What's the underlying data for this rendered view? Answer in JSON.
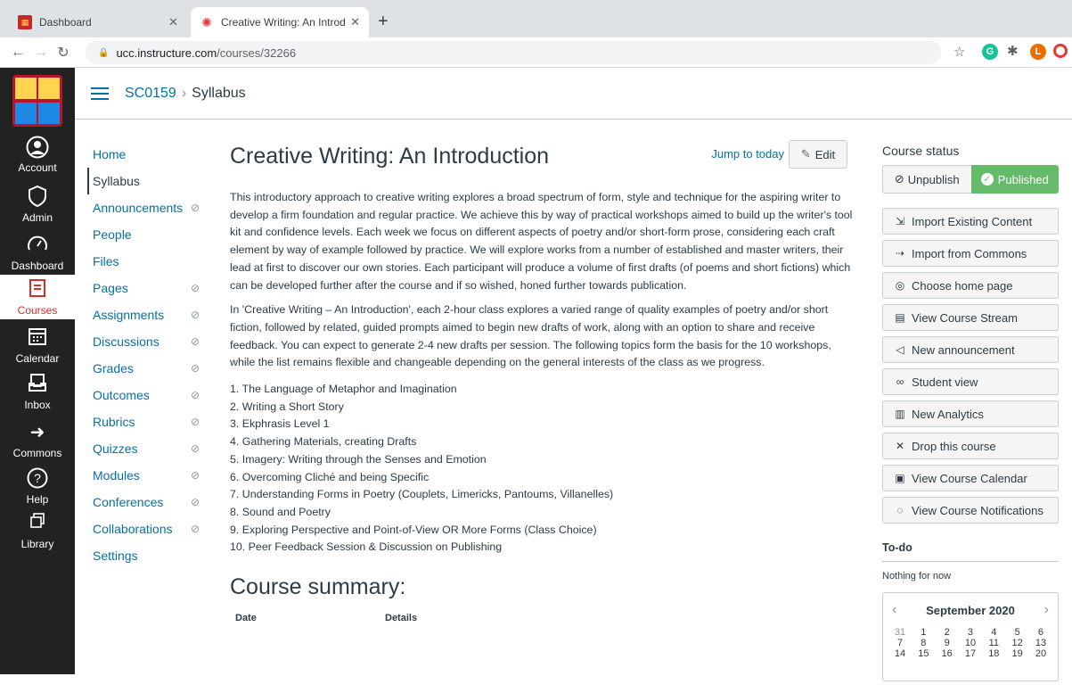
{
  "browser": {
    "tabs": [
      {
        "title": "Dashboard",
        "active": false
      },
      {
        "title": "Creative Writing: An Introducti ",
        "active": true
      }
    ],
    "url_host": "ucc.instructure.com",
    "url_path": "/courses/32266",
    "extensions": [
      {
        "name": "grammarly-icon",
        "color": "#15c39a",
        "label": "G"
      },
      {
        "name": "user-avatar-icon",
        "color": "#ef6c00",
        "label": "L"
      },
      {
        "name": "opera-icon",
        "color": "#e53935",
        "label": "O"
      }
    ]
  },
  "global_nav": {
    "items": [
      {
        "key": "account",
        "label": "Account"
      },
      {
        "key": "admin",
        "label": "Admin"
      },
      {
        "key": "dashboard",
        "label": "Dashboard"
      },
      {
        "key": "courses",
        "label": "Courses"
      },
      {
        "key": "calendar",
        "label": "Calendar"
      },
      {
        "key": "inbox",
        "label": "Inbox"
      },
      {
        "key": "commons",
        "label": "Commons"
      },
      {
        "key": "help",
        "label": "Help"
      },
      {
        "key": "library",
        "label": "Library"
      }
    ]
  },
  "breadcrumb": {
    "course": "SC0159",
    "page": "Syllabus"
  },
  "course_nav": [
    {
      "label": "Home",
      "hidden": false
    },
    {
      "label": "Syllabus",
      "hidden": false
    },
    {
      "label": "Announcements",
      "hidden": true
    },
    {
      "label": "People",
      "hidden": false
    },
    {
      "label": "Files",
      "hidden": false
    },
    {
      "label": "Pages",
      "hidden": true
    },
    {
      "label": "Assignments",
      "hidden": true
    },
    {
      "label": "Discussions",
      "hidden": true
    },
    {
      "label": "Grades",
      "hidden": true
    },
    {
      "label": "Outcomes",
      "hidden": true
    },
    {
      "label": "Rubrics",
      "hidden": true
    },
    {
      "label": "Quizzes",
      "hidden": true
    },
    {
      "label": "Modules",
      "hidden": true
    },
    {
      "label": "Conferences",
      "hidden": true
    },
    {
      "label": "Collaborations",
      "hidden": true
    },
    {
      "label": "Settings",
      "hidden": false
    }
  ],
  "main": {
    "title": "Creative Writing: An Introduction",
    "jump_to_today": "Jump to today",
    "edit_label": "Edit",
    "paragraph1": "This introductory approach to creative writing explores a broad spectrum of form, style and technique for the aspiring writer to develop a firm foundation and regular practice. We achieve this by way of practical workshops aimed to build up the writer's tool kit and confidence levels. Each week we focus on different aspects of poetry and/or short-form prose, considering each craft element by way of example followed by practice. We will explore works from a number of established and master writers, their lead at first to discover our own stories. Each participant will produce a volume of first drafts (of poems and short fictions) which can be developed further after the course and if so wished, honed further towards publication.",
    "paragraph2": "In 'Creative Writing – An Introduction', each 2-hour class explores a varied range of quality examples of poetry and/or short fiction, followed by related, guided prompts aimed to begin new drafts of work, along with an option to share and receive feedback. You can expect to generate 2-4 new drafts per session. The following topics form the basis for the 10 workshops, while the list remains flexible and changeable depending on the general interests of the class as we progress.",
    "topics": [
      "1. The Language of Metaphor and Imagination",
      "2. Writing a Short Story",
      "3. Ekphrasis Level 1",
      "4. Gathering Materials, creating Drafts",
      "5. Imagery: Writing through the Senses and Emotion",
      "6. Overcoming Cliché and being Specific",
      "7. Understanding Forms in Poetry (Couplets, Limericks, Pantoums, Villanelles)",
      "8. Sound and Poetry",
      "9. Exploring Perspective and Point-of-View OR More Forms (Class Choice)",
      "10. Peer Feedback Session & Discussion on Publishing"
    ],
    "summary_title": "Course summary:",
    "summary_columns": [
      "Date",
      "Details"
    ]
  },
  "sidebar": {
    "course_status": "Course status",
    "unpublish": "Unpublish",
    "published": "Published",
    "buttons": [
      {
        "label": "Import Existing Content",
        "icon": "import-icon"
      },
      {
        "label": "Import from Commons",
        "icon": "commons-icon"
      },
      {
        "label": "Choose home page",
        "icon": "target-icon"
      },
      {
        "label": "View Course Stream",
        "icon": "stream-icon"
      },
      {
        "label": "New announcement",
        "icon": "megaphone-icon"
      },
      {
        "label": "Student view",
        "icon": "glasses-icon"
      },
      {
        "label": "New Analytics",
        "icon": "analytics-icon"
      },
      {
        "label": "Drop this course",
        "icon": "x-icon"
      },
      {
        "label": "View Course Calendar",
        "icon": "calendar-icon"
      },
      {
        "label": "View Course Notifications",
        "icon": "bell-icon"
      }
    ],
    "todo_title": "To-do",
    "todo_empty": "Nothing for now",
    "calendar": {
      "month": "September 2020",
      "weeks": [
        [
          "31",
          "1",
          "2",
          "3",
          "4",
          "5",
          "6"
        ],
        [
          "7",
          "8",
          "9",
          "10",
          "11",
          "12",
          "13"
        ],
        [
          "14",
          "15",
          "16",
          "17",
          "18",
          "19",
          "20"
        ]
      ]
    }
  }
}
